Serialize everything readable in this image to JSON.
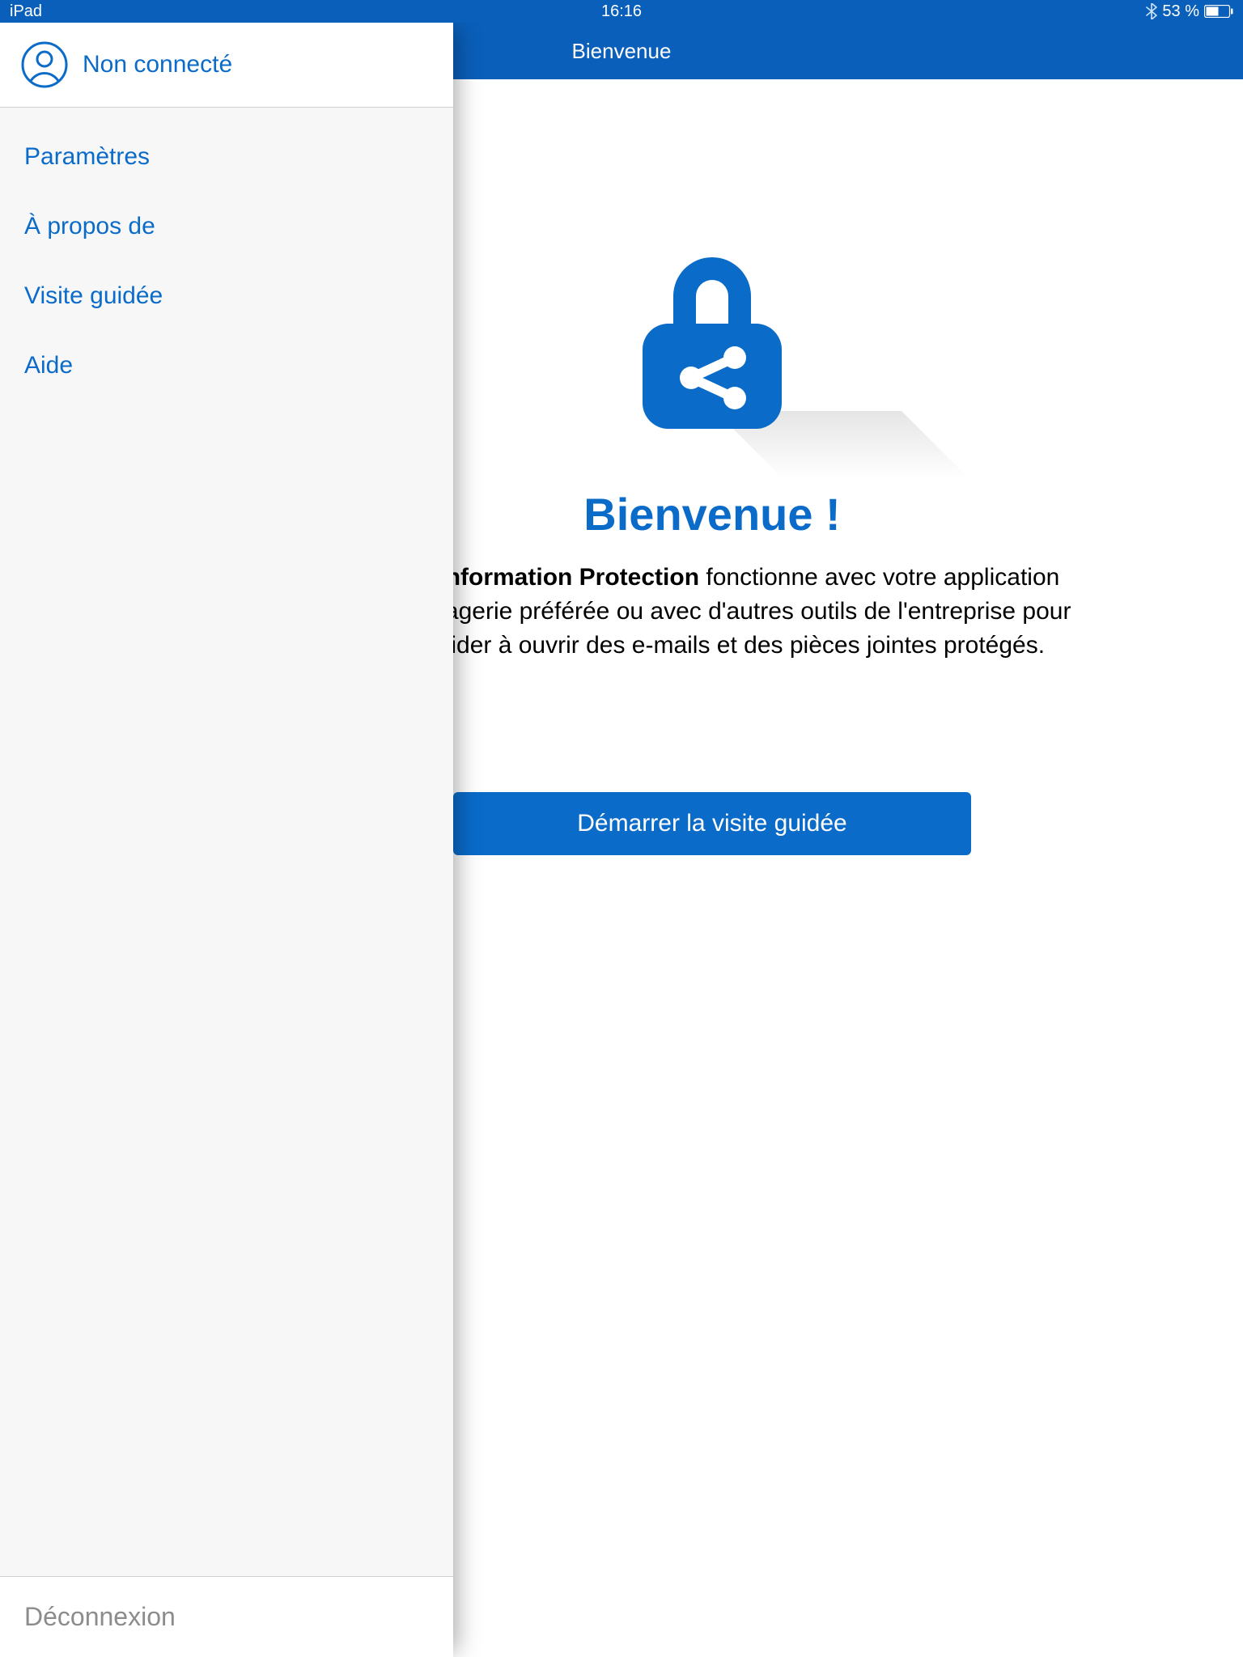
{
  "status": {
    "device": "iPad",
    "time": "16:16",
    "battery_text": "53 %",
    "battery_pct": 53
  },
  "sidebar": {
    "user_status": "Non connecté",
    "items": [
      {
        "label": "Paramètres"
      },
      {
        "label": "À propos de"
      },
      {
        "label": "Visite guidée"
      },
      {
        "label": "Aide"
      }
    ],
    "logout": "Déconnexion"
  },
  "content": {
    "header_title": "Bienvenue",
    "welcome_heading": "Bienvenue !",
    "product_name": "Azure Information Protection",
    "description_part1": " fonctionne avec votre application de messagerie préférée ou avec d'autres outils de l'entreprise pour vous aider à ouvrir des e-mails et des pièces jointes protégés.",
    "start_button": "Démarrer la visite guidée"
  }
}
